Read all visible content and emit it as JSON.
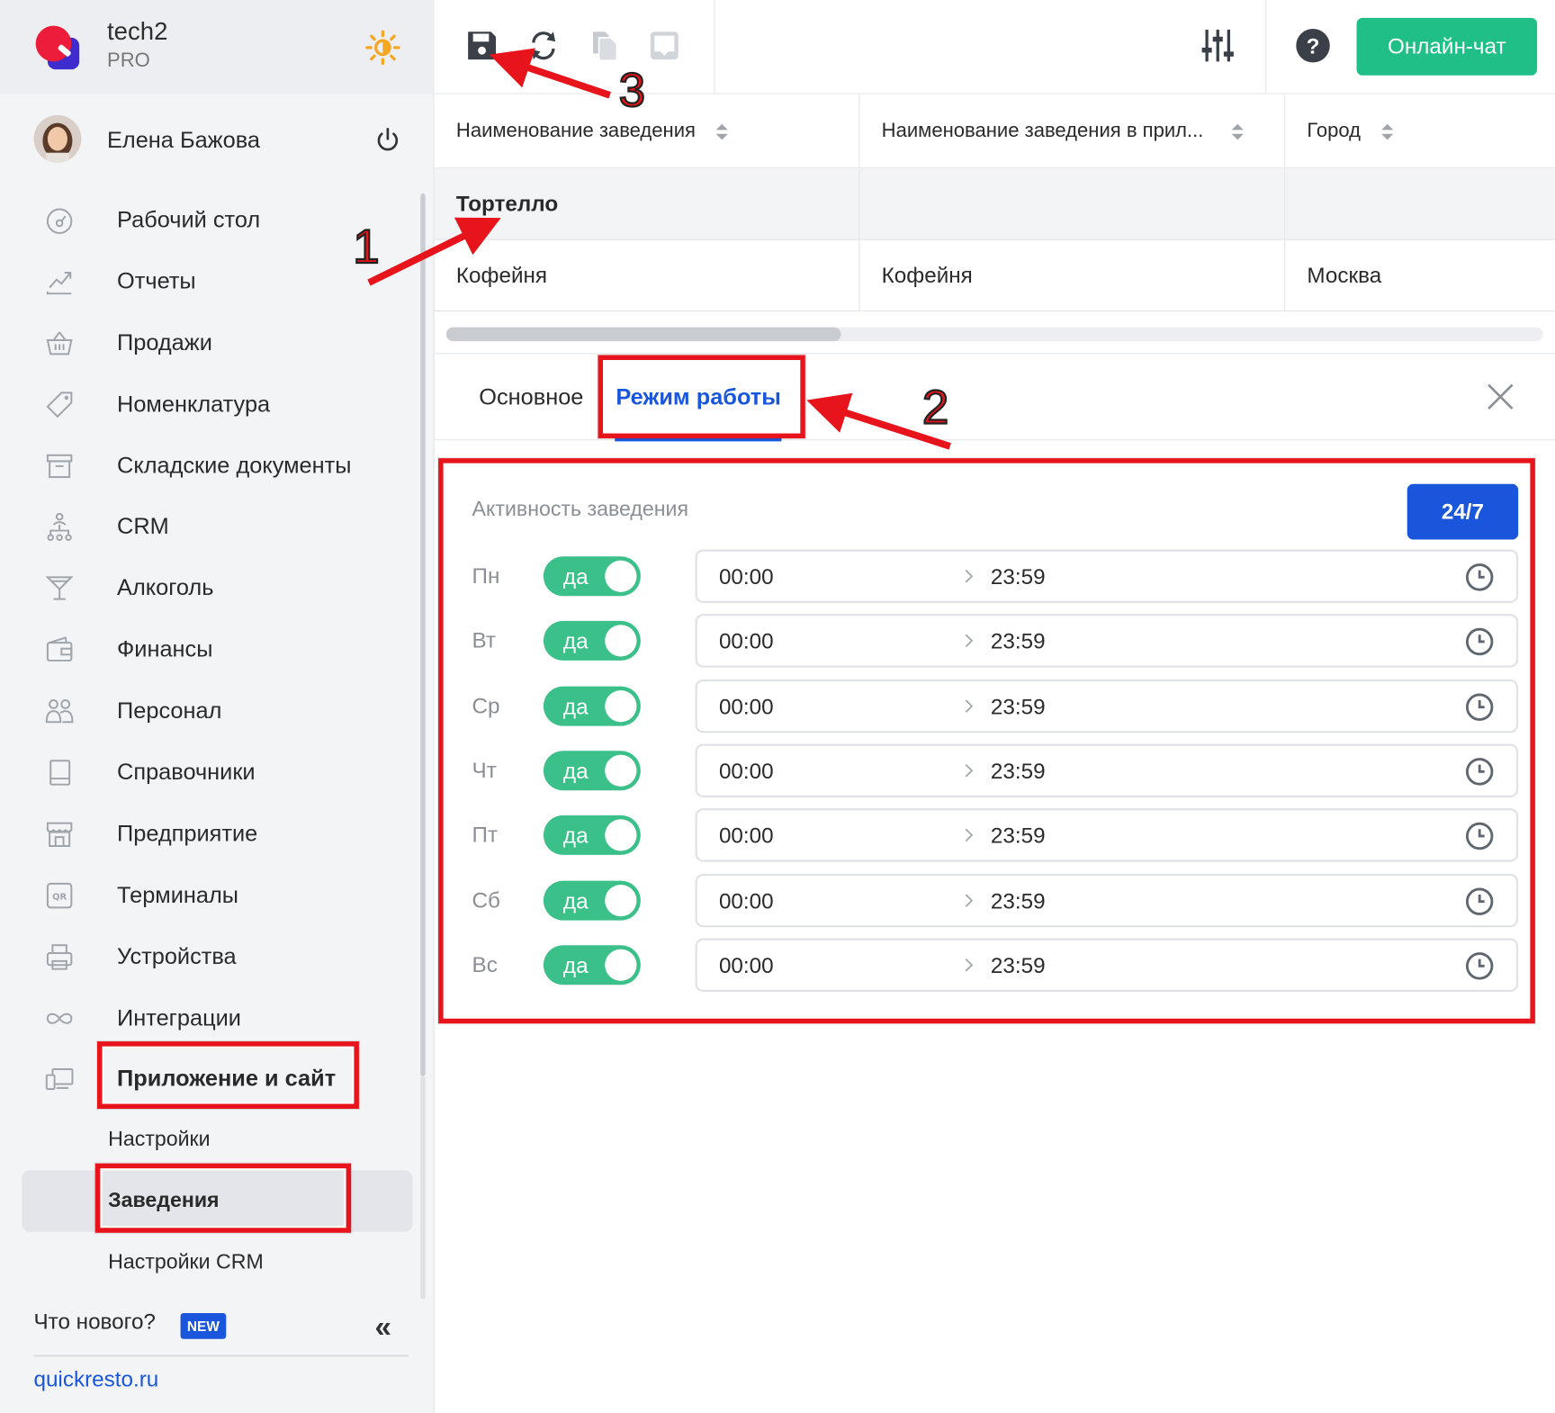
{
  "app": {
    "brand": "tech2",
    "plan": "PRO"
  },
  "user": {
    "name": "Елена Бажова"
  },
  "sidebar": {
    "items": [
      {
        "label": "Рабочий стол",
        "icon": "dashboard-gauge-icon"
      },
      {
        "label": "Отчеты",
        "icon": "chart-trend-icon"
      },
      {
        "label": "Продажи",
        "icon": "basket-icon"
      },
      {
        "label": "Номенклатура",
        "icon": "tag-icon"
      },
      {
        "label": "Складские документы",
        "icon": "archive-box-icon"
      },
      {
        "label": "CRM",
        "icon": "org-tree-icon"
      },
      {
        "label": "Алкоголь",
        "icon": "cocktail-glass-icon"
      },
      {
        "label": "Финансы",
        "icon": "wallet-icon"
      },
      {
        "label": "Персонал",
        "icon": "people-icon"
      },
      {
        "label": "Справочники",
        "icon": "book-icon"
      },
      {
        "label": "Предприятие",
        "icon": "store-icon"
      },
      {
        "label": "Терминалы",
        "icon": "qr-code-icon"
      },
      {
        "label": "Устройства",
        "icon": "printer-icon"
      },
      {
        "label": "Интеграции",
        "icon": "infinity-icon"
      },
      {
        "label": "Приложение и сайт",
        "icon": "devices-icon"
      }
    ],
    "subitems": [
      {
        "label": "Настройки"
      },
      {
        "label": "Заведения"
      },
      {
        "label": "Настройки CRM"
      }
    ],
    "whats_new": "Что нового?",
    "new_badge": "NEW",
    "site_link": "quickresto.ru"
  },
  "toolbar": {
    "chat_button": "Онлайн-чат",
    "icons": [
      "save-icon",
      "refresh-icon",
      "copy-icon",
      "inbox-icon",
      "sliders-icon",
      "help-icon"
    ]
  },
  "grid": {
    "columns": [
      "Наименование заведения",
      "Наименование заведения в прил...",
      "Город"
    ],
    "rows": [
      [
        "Тортелло",
        "",
        ""
      ],
      [
        "Кофейня",
        "Кофейня",
        "Москва"
      ]
    ],
    "scroll_fraction": 0.36
  },
  "tabs": {
    "main": "Основное",
    "schedule": "Режим работы"
  },
  "schedule": {
    "activity_label": "Активность заведения",
    "all_day_button": "24/7",
    "days": [
      {
        "day": "Пн",
        "on": "да",
        "from": "00:00",
        "to": "23:59"
      },
      {
        "day": "Вт",
        "on": "да",
        "from": "00:00",
        "to": "23:59"
      },
      {
        "day": "Ср",
        "on": "да",
        "from": "00:00",
        "to": "23:59"
      },
      {
        "day": "Чт",
        "on": "да",
        "from": "00:00",
        "to": "23:59"
      },
      {
        "day": "Пт",
        "on": "да",
        "from": "00:00",
        "to": "23:59"
      },
      {
        "day": "Сб",
        "on": "да",
        "from": "00:00",
        "to": "23:59"
      },
      {
        "day": "Вс",
        "on": "да",
        "from": "00:00",
        "to": "23:59"
      }
    ]
  },
  "annotations": [
    "1",
    "2",
    "3"
  ],
  "colors": {
    "accent": "#1a56db",
    "success": "#1fbf87",
    "toggle": "#3cc08a",
    "annotation": "#e8141b"
  }
}
